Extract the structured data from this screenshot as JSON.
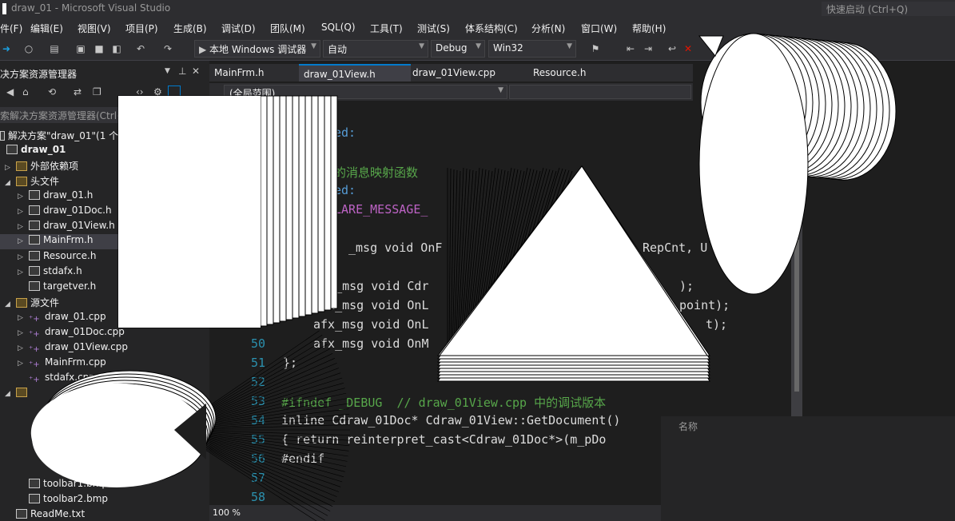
{
  "window": {
    "title": "draw_01 - Microsoft Visual Studio",
    "quick_launch": "快速启动 (Ctrl+Q)"
  },
  "menu": [
    "件(F)",
    "编辑(E)",
    "视图(V)",
    "项目(P)",
    "生成(B)",
    "调试(D)",
    "团队(M)",
    "SQL(Q)",
    "工具(T)",
    "测试(S)",
    "体系结构(C)",
    "分析(N)",
    "窗口(W)",
    "帮助(H)"
  ],
  "toolbar": {
    "debugger": "本地 Windows 调试器",
    "mode": "自动",
    "config": "Debug",
    "platform": "Win32"
  },
  "solution_explorer": {
    "title": "决方案资源管理器",
    "search_placeholder": "索解决方案资源管理器(Ctrl+;",
    "solution": "解决方案\"draw_01\"(1 个项",
    "project": "draw_01",
    "items": [
      {
        "label": "外部依赖项",
        "type": "folder"
      },
      {
        "label": "头文件",
        "type": "folder"
      },
      {
        "label": "draw_01.h",
        "type": "h"
      },
      {
        "label": "draw_01Doc.h",
        "type": "h"
      },
      {
        "label": "draw_01View.h",
        "type": "h"
      },
      {
        "label": "MainFrm.h",
        "type": "h"
      },
      {
        "label": "Resource.h",
        "type": "h"
      },
      {
        "label": "stdafx.h",
        "type": "h"
      },
      {
        "label": "targetver.h",
        "type": "h"
      },
      {
        "label": "源文件",
        "type": "folder"
      },
      {
        "label": "draw_01.cpp",
        "type": "cpp"
      },
      {
        "label": "draw_01Doc.cpp",
        "type": "cpp"
      },
      {
        "label": "draw_01View.cpp",
        "type": "cpp"
      },
      {
        "label": "MainFrm.cpp",
        "type": "cpp"
      },
      {
        "label": "stdafx.cpp",
        "type": "cpp"
      },
      {
        "label": "toolbar1.bmp",
        "type": "bmp"
      },
      {
        "label": "toolbar2.bmp",
        "type": "bmp"
      },
      {
        "label": "ReadMe.txt",
        "type": "txt"
      }
    ]
  },
  "editor": {
    "tabs": [
      "MainFrm.h",
      "draw_01View.h",
      "draw_01View.cpp",
      "Resource.h"
    ],
    "active_tab": "draw_01View.h",
    "scope": "(全局范围)",
    "zoom": "100 %",
    "line_numbers": [
      "50",
      "51",
      "52",
      "53",
      "54",
      "55",
      "56",
      "57",
      "58"
    ],
    "code_fragments": [
      "ed:",
      "的消息映射函数",
      "ed:",
      "LARE_MESSAGE_",
      "_msg void OnF",
      "RepCnt, U",
      "afx_msg void Cdr",
      ");",
      "afx_msg void OnL",
      "point);",
      "afx_msg void OnL",
      "t);",
      "afx_msg void OnM",
      "};",
      "#ifndef _DEBUG  // draw_01View.cpp 中的调试版本",
      "inline Cdraw_01Doc* Cdraw_01View::GetDocument()",
      "{ return reinterpret_cast<Cdraw_01Doc*>(m_pDo",
      "#endif"
    ]
  },
  "properties": {
    "header": "名称"
  }
}
